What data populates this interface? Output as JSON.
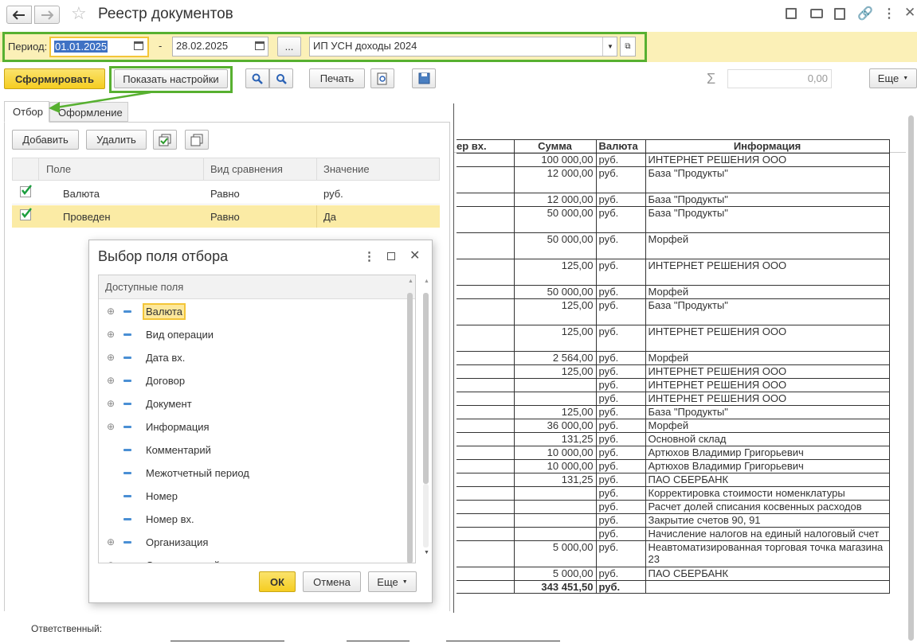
{
  "window": {
    "title": "Реестр документов"
  },
  "filter_bar": {
    "period_label": "Период:",
    "date_from": "01.01.2025",
    "dash": "-",
    "date_to": "28.02.2025",
    "dots": "...",
    "organization": "ИП УСН доходы 2024"
  },
  "toolbar": {
    "generate": "Сформировать",
    "show_settings": "Показать настройки",
    "print": "Печать",
    "sum_value": "0,00",
    "more": "Еще"
  },
  "left_panel": {
    "tabs": [
      "Отбор",
      "Оформление"
    ],
    "add": "Добавить",
    "delete": "Удалить",
    "columns": [
      "Поле",
      "Вид сравнения",
      "Значение"
    ],
    "rows": [
      {
        "field": "Валюта",
        "comparison": "Равно",
        "value": "руб.",
        "checked": true
      },
      {
        "field": "Проведен",
        "comparison": "Равно",
        "value": "Да",
        "checked": true
      }
    ]
  },
  "dialog": {
    "title": "Выбор поля отбора",
    "header": "Доступные поля",
    "items": [
      {
        "label": "Валюта",
        "expandable": true
      },
      {
        "label": "Вид операции",
        "expandable": true
      },
      {
        "label": "Дата вх.",
        "expandable": true
      },
      {
        "label": "Договор",
        "expandable": true
      },
      {
        "label": "Документ",
        "expandable": true
      },
      {
        "label": "Информация",
        "expandable": true
      },
      {
        "label": "Комментарий",
        "expandable": false
      },
      {
        "label": "Межотчетный период",
        "expandable": false
      },
      {
        "label": "Номер",
        "expandable": false
      },
      {
        "label": "Номер вх.",
        "expandable": false
      },
      {
        "label": "Организация",
        "expandable": true
      },
      {
        "label": "Ответственный",
        "expandable": true
      }
    ],
    "ok": "ОК",
    "cancel": "Отмена",
    "more": "Еще"
  },
  "report": {
    "columns": [
      "ер вх.",
      "Сумма",
      "Валюта",
      "Информация"
    ],
    "rows": [
      {
        "sum": "100 000,00",
        "cur": "руб.",
        "info": "ИНТЕРНЕТ РЕШЕНИЯ ООО",
        "h": 17
      },
      {
        "sum": "12 000,00",
        "cur": "руб.",
        "info": "База \"Продукты\"",
        "h": 33
      },
      {
        "sum": "12 000,00",
        "cur": "руб.",
        "info": "База \"Продукты\"",
        "h": 17
      },
      {
        "sum": "50 000,00",
        "cur": "руб.",
        "info": "База \"Продукты\"",
        "h": 33
      },
      {
        "sum": "50 000,00",
        "cur": "руб.",
        "info": "Морфей",
        "h": 33
      },
      {
        "sum": "125,00",
        "cur": "руб.",
        "info": "ИНТЕРНЕТ РЕШЕНИЯ ООО",
        "h": 33
      },
      {
        "sum": "50 000,00",
        "cur": "руб.",
        "info": "Морфей",
        "h": 17
      },
      {
        "sum": "125,00",
        "cur": "руб.",
        "info": "База \"Продукты\"",
        "h": 33
      },
      {
        "sum": "125,00",
        "cur": "руб.",
        "info": "ИНТЕРНЕТ РЕШЕНИЯ ООО",
        "h": 33
      },
      {
        "sum": "2 564,00",
        "cur": "руб.",
        "info": "Морфей",
        "h": 17
      },
      {
        "sum": "125,00",
        "cur": "руб.",
        "info": "ИНТЕРНЕТ РЕШЕНИЯ ООО",
        "h": 17
      },
      {
        "sum": "",
        "cur": "руб.",
        "info": "ИНТЕРНЕТ РЕШЕНИЯ ООО",
        "h": 17
      },
      {
        "sum": "",
        "cur": "руб.",
        "info": "ИНТЕРНЕТ РЕШЕНИЯ ООО",
        "h": 17
      },
      {
        "sum": "125,00",
        "cur": "руб.",
        "info": "База \"Продукты\"",
        "h": 17
      },
      {
        "sum": "36 000,00",
        "cur": "руб.",
        "info": "Морфей",
        "h": 17
      },
      {
        "sum": "131,25",
        "cur": "руб.",
        "info": "Основной склад",
        "h": 17
      },
      {
        "sum": "10 000,00",
        "cur": "руб.",
        "info": "Артюхов Владимир Григорьевич",
        "h": 17
      },
      {
        "sum": "10 000,00",
        "cur": "руб.",
        "info": "Артюхов Владимир Григорьевич",
        "h": 17
      },
      {
        "sum": "131,25",
        "cur": "руб.",
        "info": "ПАО СБЕРБАНК",
        "h": 17
      },
      {
        "sum": "",
        "cur": "руб.",
        "info": "Корректировка стоимости номенклатуры",
        "h": 17
      },
      {
        "sum": "",
        "cur": "руб.",
        "info": "Расчет долей списания косвенных расходов",
        "h": 17
      },
      {
        "sum": "",
        "cur": "руб.",
        "info": "Закрытие счетов 90, 91",
        "h": 17
      },
      {
        "sum": "",
        "cur": "руб.",
        "info": "Начисление налогов на единый налоговый счет",
        "h": 17
      },
      {
        "sum": "5 000,00",
        "cur": "руб.",
        "info": "Неавтоматизированная торговая точка магазина 23",
        "h": 33
      },
      {
        "sum": "5 000,00",
        "cur": "руб.",
        "info": "ПАО СБЕРБАНК",
        "h": 17
      }
    ],
    "total_sum": "343 451,50",
    "total_cur": "руб."
  },
  "footer": {
    "responsible_label": "Ответственный:"
  }
}
